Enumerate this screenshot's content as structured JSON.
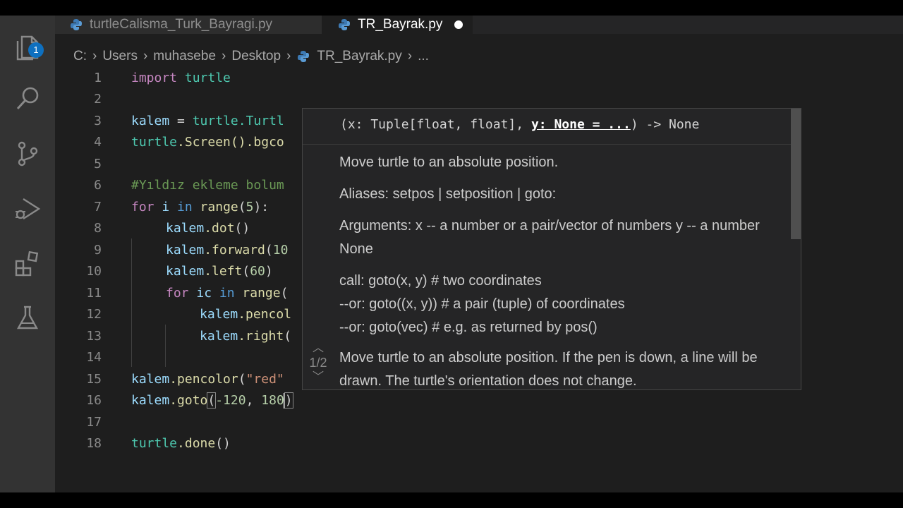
{
  "tabs": [
    {
      "label": "turtleCalisma_Turk_Bayragi.py"
    },
    {
      "label": "TR_Bayrak.py"
    }
  ],
  "activity": {
    "explorer_badge": "1"
  },
  "breadcrumb": [
    "C:",
    "Users",
    "muhasebe",
    "Desktop",
    "TR_Bayrak.py",
    "..."
  ],
  "code_lines": [
    {
      "n": "1"
    },
    {
      "n": "2"
    },
    {
      "n": "3"
    },
    {
      "n": "4"
    },
    {
      "n": "5"
    },
    {
      "n": "6"
    },
    {
      "n": "7"
    },
    {
      "n": "8"
    },
    {
      "n": "9"
    },
    {
      "n": "10"
    },
    {
      "n": "11"
    },
    {
      "n": "12"
    },
    {
      "n": "13"
    },
    {
      "n": "14"
    },
    {
      "n": "15"
    },
    {
      "n": "16"
    },
    {
      "n": "17"
    },
    {
      "n": "18"
    }
  ],
  "code": {
    "l1_kw": "import",
    "l1_mod": "turtle",
    "l3_var": "kalem",
    "l3_op": " = ",
    "l3_mod": "turtle",
    "l3_rest": ".Turtl",
    "l4_mod": "turtle",
    "l4_rest": ".Screen().bgco",
    "l6_cmt": "#Yıldız ekleme bolum",
    "l7_for": "for",
    "l7_i": " i ",
    "l7_in": "in",
    "l7_range": " range",
    "l7_rest": "(",
    "l7_num": "5",
    "l7_end": "):",
    "l8_var": "kalem",
    "l8_fn": ".dot",
    "l8_rest": "()",
    "l9_var": "kalem",
    "l9_fn": ".forward",
    "l9_rest": "(",
    "l9_num": "10",
    "l10_var": "kalem",
    "l10_fn": ".left",
    "l10_rest": "(",
    "l10_num": "60",
    "l10_end": ")",
    "l11_for": "for",
    "l11_ic": " ic ",
    "l11_in": "in",
    "l11_range": " range",
    "l11_rest": "(",
    "l12_var": "kalem",
    "l12_fn": ".pencol",
    "l13_var": "kalem",
    "l13_fn": ".right",
    "l13_rest": "(",
    "l15_var": "kalem",
    "l15_fn": ".pencolor",
    "l15_rest": "(",
    "l15_str": "\"red\"",
    "l16_var": "kalem",
    "l16_fn": ".goto",
    "l16_open": "(",
    "l16_num1": "-120",
    "l16_comma": ", ",
    "l16_num2": "180",
    "l16_close": ")",
    "l18_mod": "turtle",
    "l18_fn": ".done",
    "l18_rest": "()"
  },
  "hover": {
    "sig_prefix": "(x: Tuple[float, float], ",
    "sig_active": "y: None = ...",
    "sig_suffix": ") -> None",
    "counter": "1/2",
    "doc_1": "Move turtle to an absolute position.",
    "doc_2": "Aliases: setpos | setposition | goto:",
    "doc_3": "Arguments: x -- a number or a pair/vector of numbers y -- a number None",
    "call_1": "call: goto(x, y) # two coordinates",
    "call_2": "--or: goto((x, y)) # a pair (tuple) of coordinates",
    "call_3": "--or: goto(vec) # e.g. as returned by pos()",
    "doc_4": "Move turtle to an absolute position. If the pen is down, a line will be drawn. The turtle's orientation does not change."
  },
  "colors": {
    "editor_bg": "#1e1e1e",
    "activity_bg": "#333333",
    "badge": "#0e70c0",
    "keyword": "#c586c0",
    "class": "#4ec9b0",
    "variable": "#9cdcfe",
    "function": "#dcdcaa",
    "string": "#ce9178",
    "number": "#b5cea8",
    "comment": "#6a9955"
  }
}
